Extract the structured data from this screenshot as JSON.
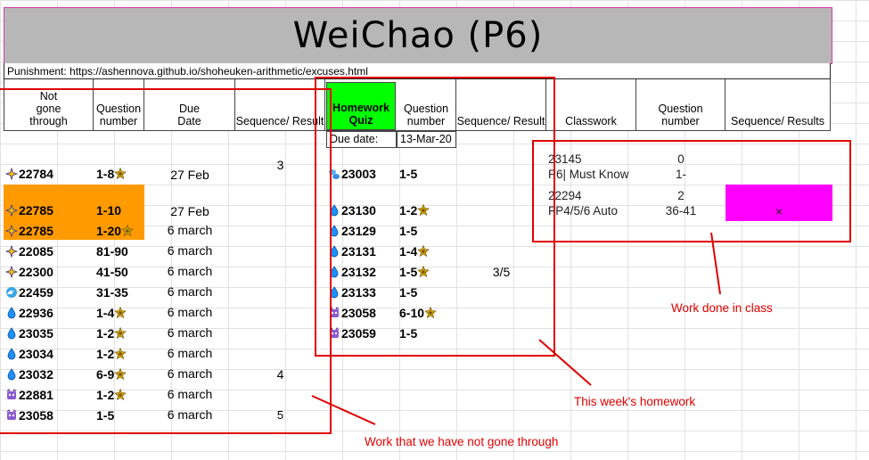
{
  "title": "WeiChao (P6)",
  "punishment": "Punishment: https://ashennova.github.io/shoheuken-arithmetic/excuses.html",
  "headers": {
    "not_gone": "Not\ngone\nthrough",
    "question_number": "Question\nnumber",
    "due_date": "Due\nDate",
    "sequence_result": "Sequence/ Result",
    "homework_quiz": "Homework\nQuiz",
    "hw_question_number": "Question\nnumber",
    "hw_sequence_result": "Sequence/ Result",
    "classwork": "Classwork",
    "cw_question_number": "Question\nnumber",
    "cw_sequence_results": "Sequence/ Results"
  },
  "hw_due": {
    "label": "Due date:",
    "value": "13-Mar-20"
  },
  "not_gone_rows": [
    {
      "icon": "sparkle-icon",
      "id": "22784",
      "q": "1-8",
      "star": true,
      "due": "27 Feb",
      "result": "3",
      "highlight": false
    },
    {
      "icon": "sparkle-icon",
      "id": "22785",
      "q": "1-10",
      "star": false,
      "due": "27 Feb",
      "result": "",
      "highlight": true
    },
    {
      "icon": "sparkle-icon",
      "id": "22785",
      "q": "1-20",
      "star": true,
      "due": "6 march",
      "result": "",
      "highlight": true
    },
    {
      "icon": "sparkle-icon",
      "id": "22085",
      "q": "81-90",
      "star": false,
      "due": "6 march",
      "result": "",
      "highlight": false
    },
    {
      "icon": "sparkle-icon",
      "id": "22300",
      "q": "41-50",
      "star": false,
      "due": "6 march",
      "result": "",
      "highlight": false
    },
    {
      "icon": "wave-icon",
      "id": "22459",
      "q": "31-35",
      "star": false,
      "due": "6 march",
      "result": "",
      "highlight": false
    },
    {
      "icon": "droplet-icon",
      "id": "22936",
      "q": "1-4",
      "star": true,
      "due": "6 march",
      "result": "",
      "highlight": false
    },
    {
      "icon": "droplet-icon",
      "id": "23035",
      "q": "1-2",
      "star": true,
      "due": "6 march",
      "result": "",
      "highlight": false
    },
    {
      "icon": "droplet-icon",
      "id": "23034",
      "q": "1-2",
      "star": true,
      "due": "6 march",
      "result": "",
      "highlight": false
    },
    {
      "icon": "droplet-icon",
      "id": "23032",
      "q": "6-9",
      "star": true,
      "due": "6 march",
      "result": "4",
      "highlight": false
    },
    {
      "icon": "monster-icon",
      "id": "22881",
      "q": "1-2",
      "star": true,
      "due": "6 march",
      "result": "",
      "highlight": false
    },
    {
      "icon": "monster-icon",
      "id": "23058",
      "q": "1-5",
      "star": false,
      "due": "6 march",
      "result": "5",
      "highlight": false
    }
  ],
  "homework_rows": [
    {
      "icon": "bubbles-icon",
      "id": "23003",
      "q": "1-5",
      "star": false,
      "result": ""
    },
    {
      "icon": "droplet-icon",
      "id": "23130",
      "q": "1-2",
      "star": true,
      "result": ""
    },
    {
      "icon": "droplet-icon",
      "id": "23129",
      "q": "1-5",
      "star": false,
      "result": ""
    },
    {
      "icon": "droplet-icon",
      "id": "23131",
      "q": "1-4",
      "star": true,
      "result": ""
    },
    {
      "icon": "droplet-icon",
      "id": "23132",
      "q": "1-5",
      "star": true,
      "result": "3/5"
    },
    {
      "icon": "droplet-icon",
      "id": "23133",
      "q": "1-5",
      "star": false,
      "result": ""
    },
    {
      "icon": "monster-icon",
      "id": "23058",
      "q": "6-10",
      "star": true,
      "result": ""
    },
    {
      "icon": "monster-icon",
      "id": "23059",
      "q": "1-5",
      "star": false,
      "result": ""
    }
  ],
  "classwork_rows": [
    {
      "id": "23145",
      "name": "P6| Must Know",
      "q_top": "0",
      "q_bottom": "1-",
      "result": "",
      "highlight": false
    },
    {
      "id": "22294",
      "name": "FP4/5/6 Auto",
      "q_top": "2",
      "q_bottom": "36-41",
      "result": "×",
      "highlight": true
    }
  ],
  "annotations": {
    "classwork": "Work done in class",
    "homework": "This week's homework",
    "not_gone": "Work that we have not gone through"
  },
  "colors": {
    "title_bg": "#b7b7b7",
    "homework_header": "#00ff00",
    "orange_highlight": "#ff9a00",
    "magenta_highlight": "#ff00ff",
    "annotation_red": "#e00000"
  }
}
